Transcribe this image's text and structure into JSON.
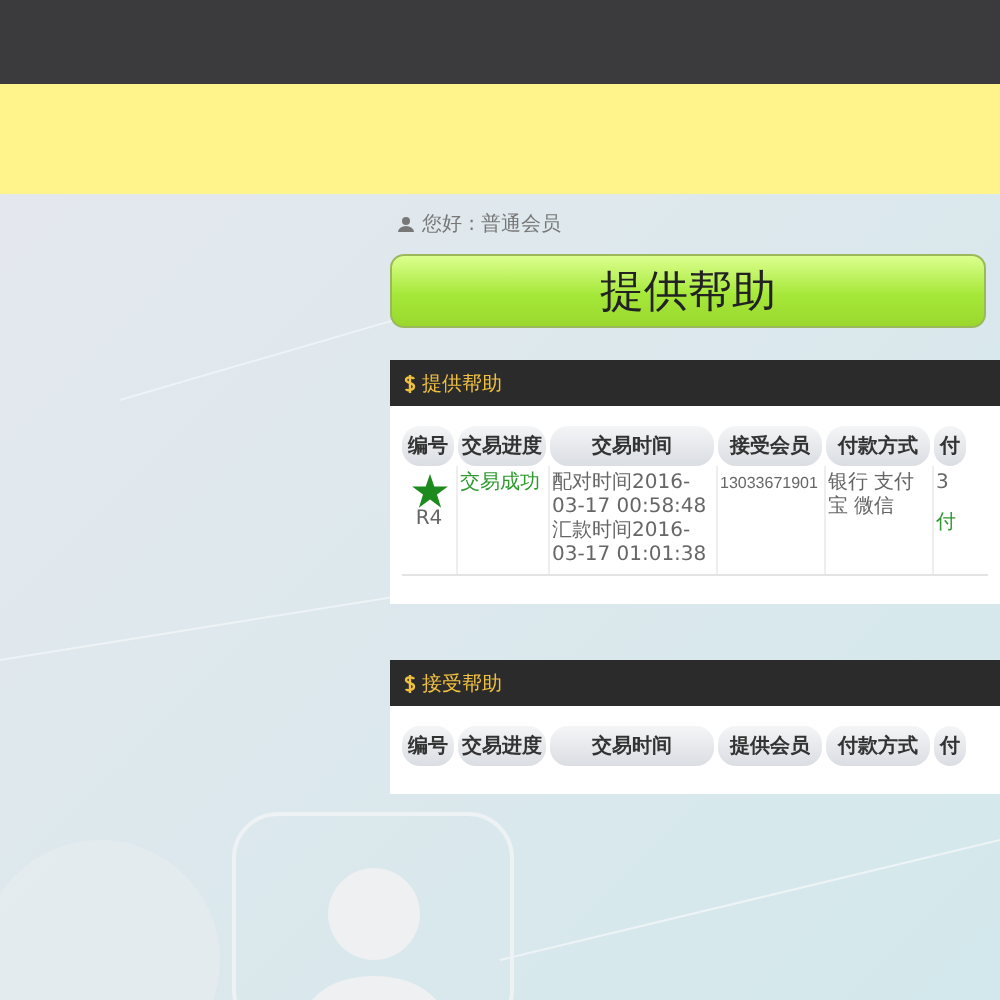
{
  "breadcrumb": "您好 : 普通会员",
  "main_button": "提供帮助",
  "panels": [
    {
      "title": "提供帮助",
      "columns": [
        "编号",
        "交易进度",
        "交易时间",
        "接受会员",
        "付款方式",
        "付"
      ],
      "rows": [
        {
          "rank": "R4",
          "status": "交易成功",
          "times": [
            "配对时间2016-03-17 00:58:48",
            "汇款时间2016-03-17 01:01:38"
          ],
          "member": "13033671901",
          "payment": "银行 支付宝 微信",
          "column_6": [
            "3",
            "付"
          ]
        }
      ]
    },
    {
      "title": "接受帮助",
      "columns": [
        "编号",
        "交易进度",
        "交易时间",
        "提供会员",
        "付款方式",
        "付"
      ]
    }
  ]
}
